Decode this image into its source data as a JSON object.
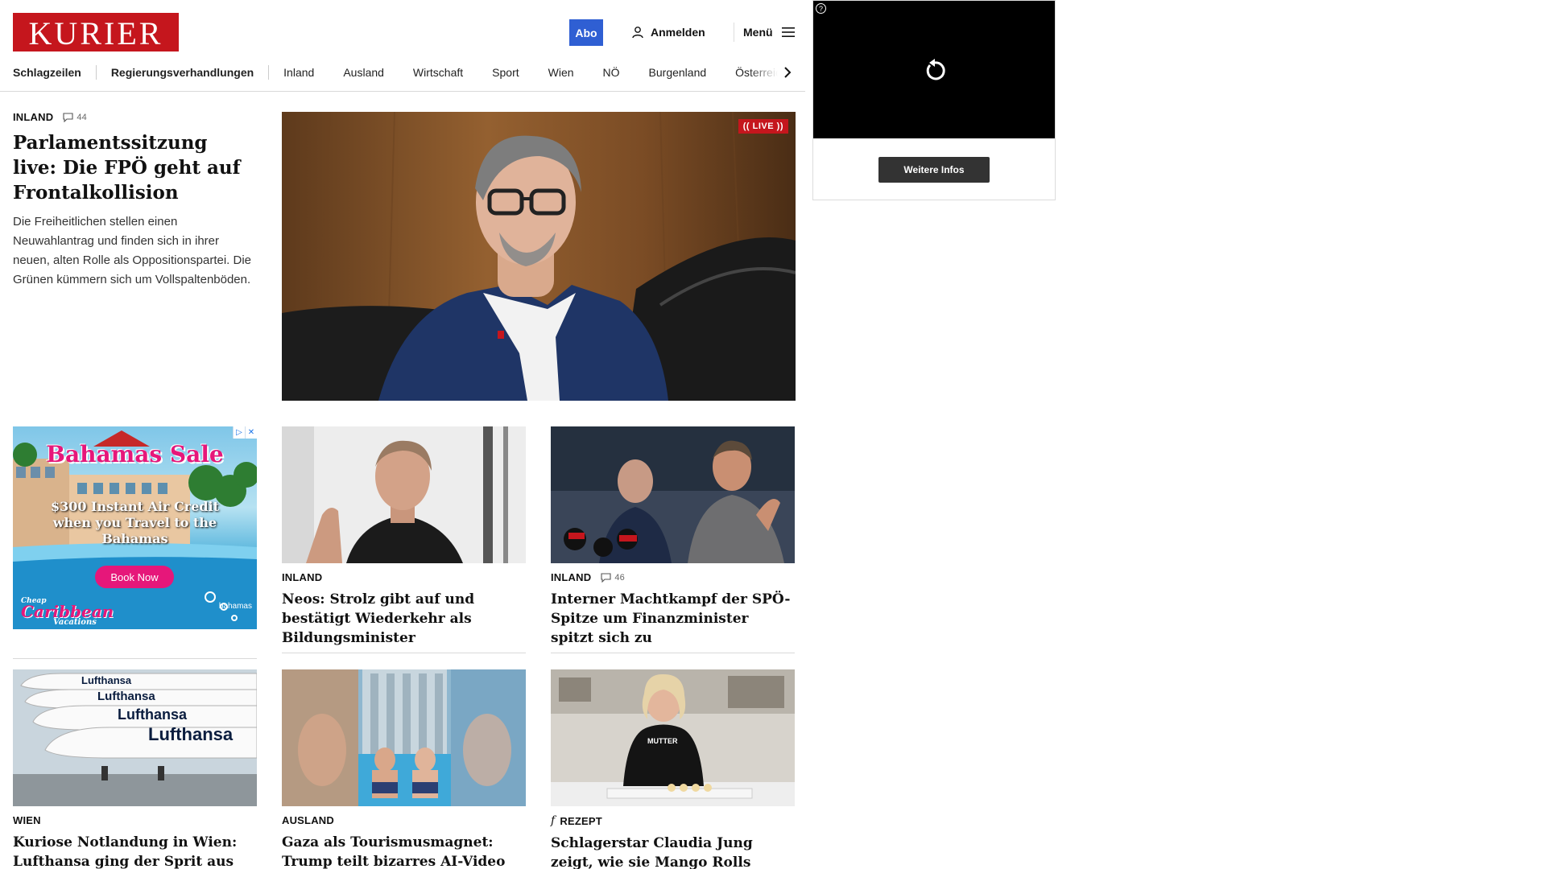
{
  "header": {
    "logo": "KURIER",
    "abo_label": "Abo",
    "login_label": "Anmelden",
    "menu_label": "Menü"
  },
  "nav": {
    "items": [
      "Schlagzeilen",
      "Regierungsverhandlungen",
      "Inland",
      "Ausland",
      "Wirtschaft",
      "Sport",
      "Wien",
      "NÖ",
      "Burgenland",
      "Österreich"
    ]
  },
  "hero": {
    "category": "INLAND",
    "comments": "44",
    "title": "Parlamentssitzung live: Die FPÖ geht auf Frontalkollision",
    "teaser": "Die Freiheitlichen stellen einen Neuwahlantrag und finden sich in ihrer neuen, alten Rolle als Oppositionspartei. Die Grünen kümmern sich um Vollspaltenböden.",
    "live_label": "LIVE"
  },
  "ad": {
    "headline_1": "Bahamas",
    "headline_2": "Sale",
    "offer": "$300 Instant Air Credit when you Travel to the Bahamas",
    "cta": "Book Now",
    "brand": "Caribbean",
    "brand_sub": "Vacations",
    "brand_pre": "Cheap",
    "logo_text": "bahamas"
  },
  "cards": [
    {
      "category": "INLAND",
      "comments": "",
      "title": "Neos: Strolz gibt auf und bestätigt Wiederkehr als Bildungsminister"
    },
    {
      "category": "INLAND",
      "comments": "46",
      "title": "Interner Machtkampf der SPÖ-Spitze um Finanzminister spitzt sich zu"
    },
    {
      "category": "WIEN",
      "comments": "",
      "title": "Kuriose Notlandung in Wien: Lufthansa ging der Sprit aus"
    },
    {
      "category": "AUSLAND",
      "comments": "",
      "title": "Gaza als Tourismusmagnet: Trump teilt bizarres AI-Video"
    },
    {
      "category": "REZEPT",
      "comments": "",
      "title": "Schlagerstar Claudia Jung zeigt, wie sie Mango Rolls macht"
    }
  ],
  "video_ad": {
    "more_info": "Weitere Infos"
  },
  "colors": {
    "brand_red": "#c5161d",
    "abo_blue": "#2f5fd3"
  }
}
